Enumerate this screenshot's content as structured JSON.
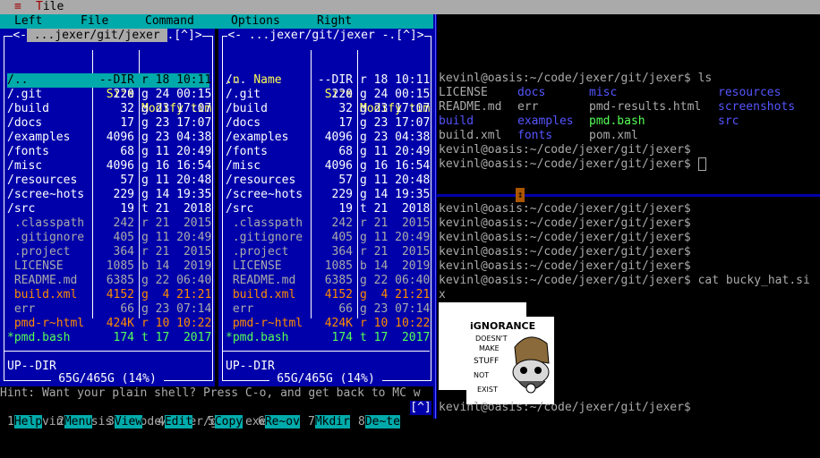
{
  "menubar": {
    "sys_icon": "≡",
    "title_hot": "T",
    "title_rest": "ile"
  },
  "mc": {
    "menu": [
      "Left",
      "File",
      "Command",
      "Options",
      "Right"
    ],
    "left_panel": {
      "title": " ...jexer/git/jexer ",
      "hotkeys": ".[^]>"
    },
    "right_panel": {
      "title": "<- ...jexer/git/jexer -.[^]>"
    },
    "columns": {
      "n": ".n",
      "name": "Name",
      "size": "Size",
      "modify": "Modify tim"
    },
    "files": [
      {
        "name": "/..",
        "size": "--DIR",
        "mtime": "r 18 10:11",
        "kind": "cursor"
      },
      {
        "name": "/.git",
        "size": "220",
        "mtime": "g 24 00:15",
        "kind": "dir"
      },
      {
        "name": "/build",
        "size": "32",
        "mtime": "g 23 17:07",
        "kind": "dir"
      },
      {
        "name": "/docs",
        "size": "17",
        "mtime": "g 23 17:07",
        "kind": "dir"
      },
      {
        "name": "/examples",
        "size": "4096",
        "mtime": "g 23 04:38",
        "kind": "dir"
      },
      {
        "name": "/fonts",
        "size": "68",
        "mtime": "g 11 20:49",
        "kind": "dir"
      },
      {
        "name": "/misc",
        "size": "4096",
        "mtime": "g 16 16:54",
        "kind": "dir"
      },
      {
        "name": "/resources",
        "size": "57",
        "mtime": "g 11 20:48",
        "kind": "dir"
      },
      {
        "name": "/scree~hots",
        "size": "229",
        "mtime": "g 14 19:35",
        "kind": "dir"
      },
      {
        "name": "/src",
        "size": "19",
        "mtime": "t 21  2018",
        "kind": "dir"
      },
      {
        "name": " .classpath",
        "size": "242",
        "mtime": "r 21  2015",
        "kind": "gray"
      },
      {
        "name": " .gitignore",
        "size": "405",
        "mtime": "g 11 20:49",
        "kind": "gray"
      },
      {
        "name": " .project",
        "size": "364",
        "mtime": "r 21  2015",
        "kind": "gray"
      },
      {
        "name": " LICENSE",
        "size": "1085",
        "mtime": "b 14  2019",
        "kind": "gray"
      },
      {
        "name": " README.md",
        "size": "6385",
        "mtime": "g 22 06:40",
        "kind": "gray"
      },
      {
        "name": " build.xml",
        "size": "4152",
        "mtime": "g  4 21:21",
        "kind": "orange"
      },
      {
        "name": " err",
        "size": "66",
        "mtime": "g 23 07:14",
        "kind": "gray"
      },
      {
        "name": " pmd-r~html",
        "size": "424K",
        "mtime": "r 10 10:22",
        "kind": "orange"
      },
      {
        "name": "*pmd.bash",
        "size": "174",
        "mtime": "t 17  2017",
        "kind": "green"
      }
    ],
    "status": "UP--DIR",
    "disk": " 65G/465G (14%) ",
    "hint": "Hint: Want your plain shell? Press C-o, and get back to MC w",
    "prompt": "kevinl@oasis:~/code/jexer/git/jexer$",
    "prompt_flag": "[^]",
    "fkeys": [
      {
        "num": "1",
        "label": "Help"
      },
      {
        "num": "2",
        "label": "Menu"
      },
      {
        "num": "3",
        "label": "View"
      },
      {
        "num": "4",
        "label": "Edit"
      },
      {
        "num": "5",
        "label": "Copy"
      },
      {
        "num": "6",
        "label": "Re~ov"
      },
      {
        "num": "7",
        "label": "Mkdir"
      },
      {
        "num": "8",
        "label": "De~te"
      }
    ]
  },
  "term_top": {
    "prompt_ls": "kevinl@oasis:~/code/jexer/git/jexer$ ls",
    "ls_rows": [
      [
        {
          "t": "LICENSE",
          "c": "plain"
        },
        {
          "t": "docs",
          "c": "blue"
        },
        {
          "t": "misc",
          "c": "blue"
        },
        {
          "t": "resources",
          "c": "blue"
        }
      ],
      [
        {
          "t": "README.md",
          "c": "plain"
        },
        {
          "t": "err",
          "c": "plain"
        },
        {
          "t": "pmd-results.html",
          "c": "plain"
        },
        {
          "t": "screenshots",
          "c": "blue"
        }
      ],
      [
        {
          "t": "build",
          "c": "blue"
        },
        {
          "t": "examples",
          "c": "blue"
        },
        {
          "t": "pmd.bash",
          "c": "green"
        },
        {
          "t": "src",
          "c": "blue"
        }
      ],
      [
        {
          "t": "build.xml",
          "c": "plain"
        },
        {
          "t": "fonts",
          "c": "blue"
        },
        {
          "t": "pom.xml",
          "c": "plain"
        },
        {
          "t": "",
          "c": "plain"
        }
      ]
    ],
    "prompt1": "kevinl@oasis:~/code/jexer/git/jexer$",
    "prompt2": "kevinl@oasis:~/code/jexer/git/jexer$"
  },
  "term_bottom": {
    "lines": [
      "kevinl@oasis:~/code/jexer/git/jexer$",
      "kevinl@oasis:~/code/jexer/git/jexer$",
      "kevinl@oasis:~/code/jexer/git/jexer$",
      "kevinl@oasis:~/code/jexer/git/jexer$",
      "kevinl@oasis:~/code/jexer/git/jexer$",
      "kevinl@oasis:~/code/jexer/git/jexer$ cat bucky_hat.si",
      "x"
    ],
    "image_text": [
      "iGNORANCE",
      "DOESN'T",
      "MAKE",
      "STUFF",
      "NOT",
      "EXIST"
    ],
    "last_prompt": "kevinl@oasis:~/code/jexer/git/jexer$"
  }
}
